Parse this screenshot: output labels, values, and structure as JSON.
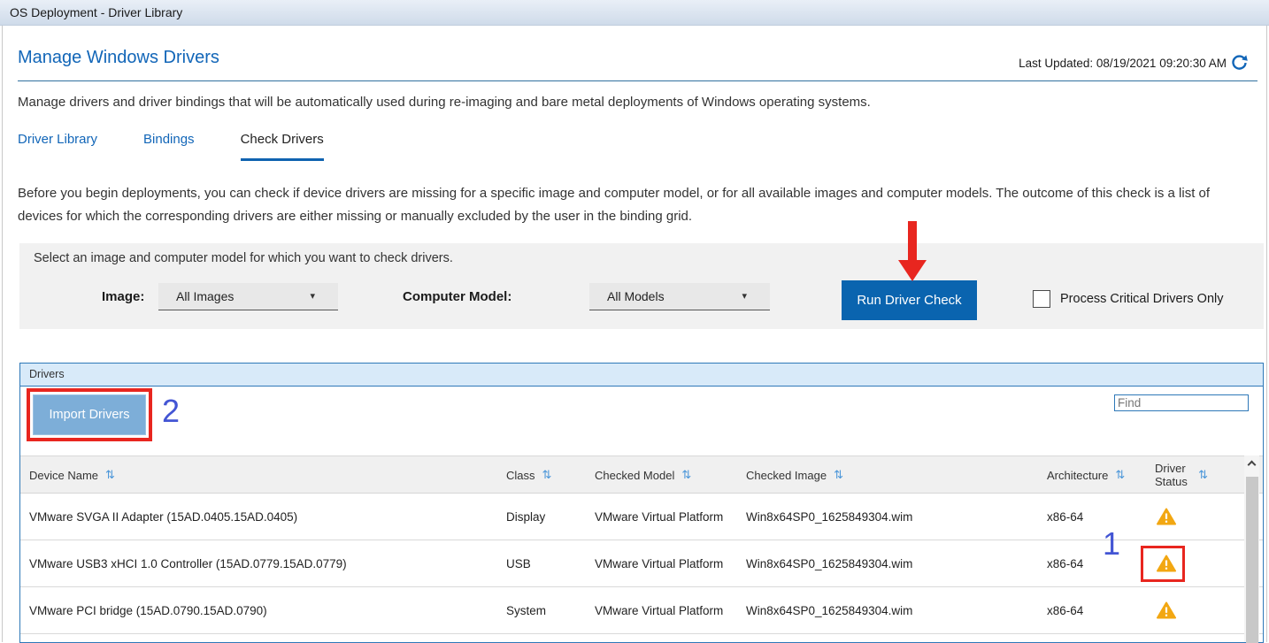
{
  "titlebar": {
    "text": "OS Deployment - Driver Library"
  },
  "header": {
    "title": "Manage Windows Drivers",
    "last_updated": "Last Updated: 08/19/2021 09:20:30 AM"
  },
  "intro": "Manage drivers and driver bindings that will be automatically used during re-imaging and bare metal deployments of Windows operating systems.",
  "tabs": [
    {
      "label": "Driver Library",
      "active": false
    },
    {
      "label": "Bindings",
      "active": false
    },
    {
      "label": "Check Drivers",
      "active": true
    }
  ],
  "description": "Before you begin deployments, you can check if device drivers are missing for a specific image and computer model, or for all available images and computer models. The outcome of this check is a list of devices for which the corresponding drivers are either missing or manually excluded by the user in the binding grid.",
  "check_panel": {
    "instruction": "Select an image and computer model for which you want to check drivers.",
    "image_label": "Image:",
    "image_value": "All Images",
    "model_label": "Computer Model:",
    "model_value": "All Models",
    "run_button_label": "Run Driver Check",
    "checkbox_label": "Process Critical Drivers Only",
    "checkbox_checked": false
  },
  "drivers_panel": {
    "title": "Drivers",
    "import_button_label": "Import Drivers",
    "find_placeholder": "Find"
  },
  "annotations": {
    "step_1": "1",
    "step_2": "2",
    "number_color": "#4355d4",
    "highlight_color": "#e8261f"
  },
  "table": {
    "columns": [
      {
        "label": "Device Name",
        "sortable": true
      },
      {
        "label": "Class",
        "sortable": true
      },
      {
        "label": "Checked Model",
        "sortable": true
      },
      {
        "label": "Checked Image",
        "sortable": true
      },
      {
        "label": "Architecture",
        "sortable": true
      },
      {
        "label": "Driver Status",
        "sortable": true
      }
    ],
    "rows": [
      {
        "device_name": "VMware SVGA II Adapter (15AD.0405.15AD.0405)",
        "class": "Display",
        "checked_model": "VMware Virtual Platform",
        "checked_image": "Win8x64SP0_1625849304.wim",
        "architecture": "x86-64",
        "driver_status": "warning"
      },
      {
        "device_name": "VMware USB3 xHCI 1.0 Controller (15AD.0779.15AD.0779)",
        "class": "USB",
        "checked_model": "VMware Virtual Platform",
        "checked_image": "Win8x64SP0_1625849304.wim",
        "architecture": "x86-64",
        "driver_status": "warning",
        "highlighted": true
      },
      {
        "device_name": "VMware PCI bridge (15AD.0790.15AD.0790)",
        "class": "System",
        "checked_model": "VMware Virtual Platform",
        "checked_image": "Win8x64SP0_1625849304.wim",
        "architecture": "x86-64",
        "driver_status": "warning"
      }
    ]
  },
  "icons": {
    "sort": "⇅",
    "caret_down": "▾",
    "refresh": "refresh-circular-arrow",
    "warning": "warning-triangle",
    "chevron_up": "scroll-up-chevron"
  },
  "colors": {
    "accent_blue": "#1266b8",
    "run_button_blue": "#0a64af",
    "panel_border_blue": "#2e78b8",
    "panel_header_blue": "#d8eaf9",
    "import_button_blue": "#7daed8",
    "warning_orange": "#f2a712",
    "annotation_red": "#e8261f",
    "annotation_indigo": "#4355d4"
  }
}
